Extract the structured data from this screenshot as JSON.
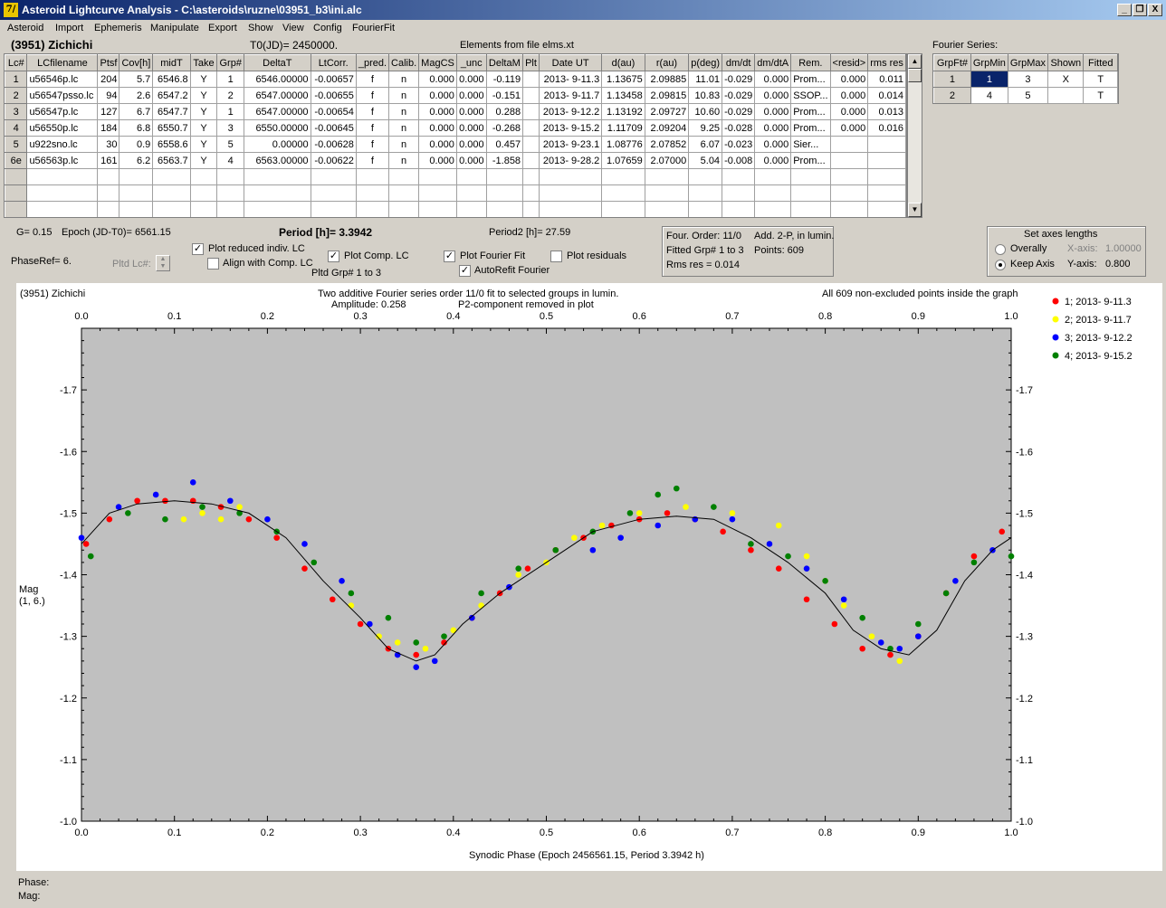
{
  "window": {
    "title": "Asteroid Lightcurve Analysis - C:\\asteroids\\ruzne\\03951_b3\\ini.alc",
    "icon_text": "7/",
    "buttons": {
      "minimize": "_",
      "restore": "❐",
      "close": "X"
    }
  },
  "menu": [
    "Asteroid",
    "Import",
    "Ephemeris",
    "Manipulate",
    "Export",
    "Show",
    "View",
    "Config",
    "FourierFit"
  ],
  "header": {
    "asteroid": "(3951) Zichichi",
    "t0": "T0(JD)= 2450000.",
    "elements": "Elements from file elms.xt",
    "fourier_label": "Fourier Series:"
  },
  "lc_table": {
    "columns": [
      "Lc#",
      "LCfilename",
      "Ptsf",
      "Cov[h]",
      "midT",
      "Take",
      "Grp#",
      "DeltaT",
      "LtCorr.",
      "_pred.",
      "Calib.",
      "MagCS",
      "_unc",
      "DeltaM",
      "Plt",
      "Date UT",
      "d(au)",
      "r(au)",
      "p(deg)",
      "dm/dt",
      "dm/dtA",
      "Rem.",
      "<resid>",
      "rms res"
    ],
    "rows": [
      [
        "1",
        "u56546p.lc",
        "204",
        "5.7",
        "6546.8",
        "Y",
        "1",
        "6546.00000",
        "-0.00657",
        "f",
        "n",
        "0.000",
        "0.000",
        "-0.119",
        "",
        "2013- 9-11.3",
        "1.13675",
        "2.09885",
        "11.01",
        "-0.029",
        "0.000",
        "Prom...",
        "0.000",
        "0.011"
      ],
      [
        "2",
        "u56547psso.lc",
        "94",
        "2.6",
        "6547.2",
        "Y",
        "2",
        "6547.00000",
        "-0.00655",
        "f",
        "n",
        "0.000",
        "0.000",
        "-0.151",
        "",
        "2013- 9-11.7",
        "1.13458",
        "2.09815",
        "10.83",
        "-0.029",
        "0.000",
        "SSOP...",
        "0.000",
        "0.014"
      ],
      [
        "3",
        "u56547p.lc",
        "127",
        "6.7",
        "6547.7",
        "Y",
        "1",
        "6547.00000",
        "-0.00654",
        "f",
        "n",
        "0.000",
        "0.000",
        "0.288",
        "",
        "2013- 9-12.2",
        "1.13192",
        "2.09727",
        "10.60",
        "-0.029",
        "0.000",
        "Prom...",
        "0.000",
        "0.013"
      ],
      [
        "4",
        "u56550p.lc",
        "184",
        "6.8",
        "6550.7",
        "Y",
        "3",
        "6550.00000",
        "-0.00645",
        "f",
        "n",
        "0.000",
        "0.000",
        "-0.268",
        "",
        "2013- 9-15.2",
        "1.11709",
        "2.09204",
        "9.25",
        "-0.028",
        "0.000",
        "Prom...",
        "0.000",
        "0.016"
      ],
      [
        "5",
        "u922sno.lc",
        "30",
        "0.9",
        "6558.6",
        "Y",
        "5",
        "0.00000",
        "-0.00628",
        "f",
        "n",
        "0.000",
        "0.000",
        "0.457",
        "",
        "2013- 9-23.1",
        "1.08776",
        "2.07852",
        "6.07",
        "-0.023",
        "0.000",
        "Sier...",
        "",
        ""
      ],
      [
        "6e",
        "u56563p.lc",
        "161",
        "6.2",
        "6563.7",
        "Y",
        "4",
        "6563.00000",
        "-0.00622",
        "f",
        "n",
        "0.000",
        "0.000",
        "-1.858",
        "",
        "2013- 9-28.2",
        "1.07659",
        "2.07000",
        "5.04",
        "-0.008",
        "0.000",
        "Prom...",
        "",
        ""
      ]
    ]
  },
  "fourier_table": {
    "columns": [
      "GrpFt#",
      "GrpMin",
      "GrpMax",
      "Shown",
      "Fitted"
    ],
    "rows": [
      [
        "1",
        "1",
        "3",
        "X",
        "T"
      ],
      [
        "2",
        "4",
        "5",
        "",
        "T"
      ]
    ]
  },
  "params": {
    "g": "G= 0.15",
    "epoch": "Epoch (JD-T0)= 6561.15",
    "period": "Period [h]= 3.3942",
    "period2": "Period2 [h]= 27.59",
    "phaseref": "PhaseRef= 6.",
    "pltd_lc": "Pltd Lc#:",
    "pltd_grp": "Pltd Grp#  1   to    3"
  },
  "checks": {
    "plot_reduced": "Plot reduced indiv. LC",
    "align_comp": "Align with Comp. LC",
    "plot_comp": "Plot Comp. LC",
    "plot_fourier": "Plot Fourier Fit",
    "plot_residuals": "Plot residuals",
    "autorefit": "AutoRefit Fourier"
  },
  "fit_info": {
    "order": "Four. Order: 11/0",
    "add": "Add. 2-P, in lumin.",
    "fitted": "Fitted Grp# 1 to 3",
    "points": "Points: 609",
    "rms": "Rms res     = 0.014"
  },
  "axes_box": {
    "title": "Set axes lengths",
    "overally": "Overally",
    "keep": "Keep Axis",
    "xaxis_label": "X-axis:",
    "xaxis_value": "1.00000",
    "yaxis_label": "Y-axis:",
    "yaxis_value": "0.800"
  },
  "footer": {
    "phase": "Phase:",
    "mag": "Mag:"
  },
  "chart_data": {
    "type": "scatter",
    "header_left": "(3951) Zichichi",
    "title": "Two additive Fourier series order 11/0 fit to selected groups in lumin.",
    "subtitle_amp": "Amplitude: 0.258",
    "subtitle_p2": "P2-component removed in plot",
    "header_right": "All 609 non-excluded points inside the graph",
    "xlabel": "Synodic Phase (Epoch 2456561.15, Period 3.3942 h)",
    "ylabel": [
      "Mag",
      "(1, 6.)"
    ],
    "xlim": [
      0.0,
      1.0
    ],
    "ylim": [
      -1.0,
      -1.8
    ],
    "x_ticks": [
      "0.0",
      "0.1",
      "0.2",
      "0.3",
      "0.4",
      "0.5",
      "0.6",
      "0.7",
      "0.8",
      "0.9",
      "1.0"
    ],
    "y_ticks": [
      "-1.0",
      "-1.1",
      "-1.2",
      "-1.3",
      "-1.4",
      "-1.5",
      "-1.6",
      "-1.7"
    ],
    "fit_curve": {
      "x": [
        0.0,
        0.03,
        0.06,
        0.1,
        0.14,
        0.18,
        0.22,
        0.26,
        0.3,
        0.33,
        0.36,
        0.38,
        0.41,
        0.45,
        0.5,
        0.55,
        0.6,
        0.64,
        0.68,
        0.72,
        0.76,
        0.8,
        0.83,
        0.86,
        0.89,
        0.92,
        0.95,
        0.98,
        1.0
      ],
      "y": [
        -1.45,
        -1.5,
        -1.515,
        -1.52,
        -1.515,
        -1.5,
        -1.46,
        -1.39,
        -1.33,
        -1.28,
        -1.26,
        -1.27,
        -1.32,
        -1.37,
        -1.42,
        -1.47,
        -1.49,
        -1.495,
        -1.49,
        -1.46,
        -1.42,
        -1.37,
        -1.31,
        -1.28,
        -1.27,
        -1.31,
        -1.39,
        -1.44,
        -1.46
      ]
    },
    "series": [
      {
        "name": "1; 2013- 9-11.3",
        "color": "#ff0000",
        "x": [
          0.005,
          0.03,
          0.06,
          0.09,
          0.12,
          0.15,
          0.18,
          0.21,
          0.24,
          0.27,
          0.3,
          0.33,
          0.36,
          0.39,
          0.42,
          0.45,
          0.48,
          0.51,
          0.54,
          0.57,
          0.6,
          0.63,
          0.66,
          0.69,
          0.72,
          0.75,
          0.78,
          0.81,
          0.84,
          0.87,
          0.9,
          0.93,
          0.96,
          0.99
        ],
        "y": [
          -1.45,
          -1.49,
          -1.52,
          -1.52,
          -1.52,
          -1.51,
          -1.49,
          -1.46,
          -1.41,
          -1.36,
          -1.32,
          -1.28,
          -1.27,
          -1.29,
          -1.33,
          -1.37,
          -1.41,
          -1.44,
          -1.46,
          -1.48,
          -1.49,
          -1.5,
          -1.49,
          -1.47,
          -1.44,
          -1.41,
          -1.36,
          -1.32,
          -1.28,
          -1.27,
          -1.3,
          -1.37,
          -1.43,
          -1.47
        ]
      },
      {
        "name": "2; 2013- 9-11.7",
        "color": "#ffff00",
        "x": [
          0.11,
          0.13,
          0.15,
          0.17,
          0.29,
          0.32,
          0.34,
          0.37,
          0.4,
          0.43,
          0.47,
          0.5,
          0.53,
          0.56,
          0.6,
          0.65,
          0.7,
          0.75,
          0.78,
          0.8,
          0.82,
          0.85,
          0.88
        ],
        "y": [
          -1.49,
          -1.5,
          -1.49,
          -1.51,
          -1.35,
          -1.3,
          -1.29,
          -1.28,
          -1.31,
          -1.35,
          -1.4,
          -1.42,
          -1.46,
          -1.48,
          -1.5,
          -1.51,
          -1.5,
          -1.48,
          -1.43,
          -1.39,
          -1.35,
          -1.3,
          -1.26
        ]
      },
      {
        "name": "3; 2013- 9-12.2",
        "color": "#0000ff",
        "x": [
          0.0,
          0.04,
          0.08,
          0.12,
          0.16,
          0.2,
          0.24,
          0.28,
          0.31,
          0.34,
          0.36,
          0.38,
          0.42,
          0.46,
          0.55,
          0.58,
          0.62,
          0.66,
          0.7,
          0.74,
          0.78,
          0.82,
          0.86,
          0.88,
          0.9,
          0.94,
          0.98
        ],
        "y": [
          -1.46,
          -1.51,
          -1.53,
          -1.55,
          -1.52,
          -1.49,
          -1.45,
          -1.39,
          -1.32,
          -1.27,
          -1.25,
          -1.26,
          -1.33,
          -1.38,
          -1.44,
          -1.46,
          -1.48,
          -1.49,
          -1.49,
          -1.45,
          -1.41,
          -1.36,
          -1.29,
          -1.28,
          -1.3,
          -1.39,
          -1.44
        ]
      },
      {
        "name": "4; 2013- 9-15.2",
        "color": "#008000",
        "x": [
          0.01,
          0.05,
          0.09,
          0.13,
          0.17,
          0.21,
          0.25,
          0.29,
          0.33,
          0.36,
          0.39,
          0.43,
          0.47,
          0.51,
          0.55,
          0.59,
          0.62,
          0.64,
          0.68,
          0.72,
          0.76,
          0.8,
          0.84,
          0.87,
          0.9,
          0.93,
          0.96,
          1.0
        ],
        "y": [
          -1.43,
          -1.5,
          -1.49,
          -1.51,
          -1.5,
          -1.47,
          -1.42,
          -1.37,
          -1.33,
          -1.29,
          -1.3,
          -1.37,
          -1.41,
          -1.44,
          -1.47,
          -1.5,
          -1.53,
          -1.54,
          -1.51,
          -1.45,
          -1.43,
          -1.39,
          -1.33,
          -1.28,
          -1.32,
          -1.37,
          -1.42,
          -1.43
        ]
      }
    ]
  }
}
